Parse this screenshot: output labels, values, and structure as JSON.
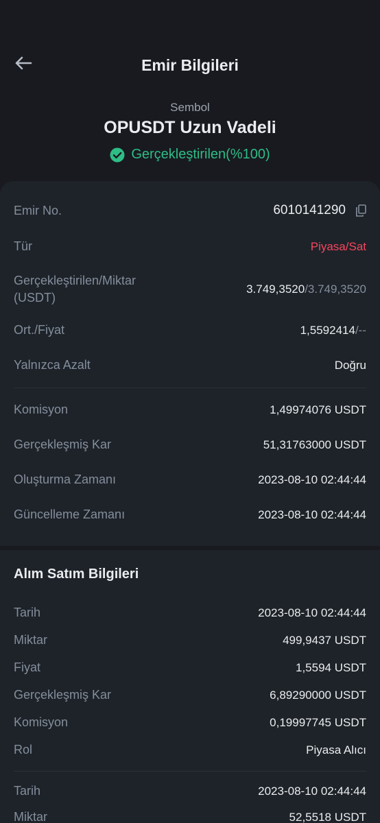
{
  "header": {
    "title": "Emir Bilgileri",
    "symbol_label": "Sembol",
    "symbol": "OPUSDT Uzun Vadeli",
    "status": "Gerçekleştirilen(%100)"
  },
  "order": {
    "order_no_label": "Emir No.",
    "order_no": "6010141290",
    "type_label": "Tür",
    "type_value": "Piyasa/Sat",
    "filled_label_line1": "Gerçekleştirilen/Miktar",
    "filled_label_line2": "(USDT)",
    "filled_value": "3.749,3520",
    "amount_value": "/3.749,3520",
    "avg_price_label": "Ort./Fiyat",
    "avg_value": "1,5592414",
    "price_value": "/--",
    "reduce_only_label": "Yalnızca Azalt",
    "reduce_only_value": "Doğru",
    "fee_label": "Komisyon",
    "fee_value": "1,49974076 USDT",
    "realized_pnl_label": "Gerçekleşmiş Kar",
    "realized_pnl_value": "51,31763000 USDT",
    "created_label": "Oluşturma Zamanı",
    "created_value": "2023-08-10 02:44:44",
    "updated_label": "Güncelleme Zamanı",
    "updated_value": "2023-08-10 02:44:44"
  },
  "trades": {
    "title": "Alım Satım Bilgileri",
    "trade1": {
      "date_label": "Tarih",
      "date_value": "2023-08-10 02:44:44",
      "qty_label": "Miktar",
      "qty_value": "499,9437 USDT",
      "price_label": "Fiyat",
      "price_value": "1,5594 USDT",
      "pnl_label": "Gerçekleşmiş Kar",
      "pnl_value": "6,89290000 USDT",
      "fee_label": "Komisyon",
      "fee_value": "0,19997745 USDT",
      "role_label": "Rol",
      "role_value": "Piyasa Alıcı"
    },
    "trade2": {
      "date_label": "Tarih",
      "date_value": "2023-08-10 02:44:44",
      "qty_label": "Miktar",
      "qty_value": "52,5518 USDT"
    }
  },
  "colors": {
    "background": "#181a20",
    "card": "#1e2329",
    "success": "#2ebd85",
    "sell": "#f6465d",
    "text_secondary": "#848e9c"
  },
  "icons": [
    "back-arrow-icon",
    "check-circle-icon",
    "copy-icon"
  ]
}
